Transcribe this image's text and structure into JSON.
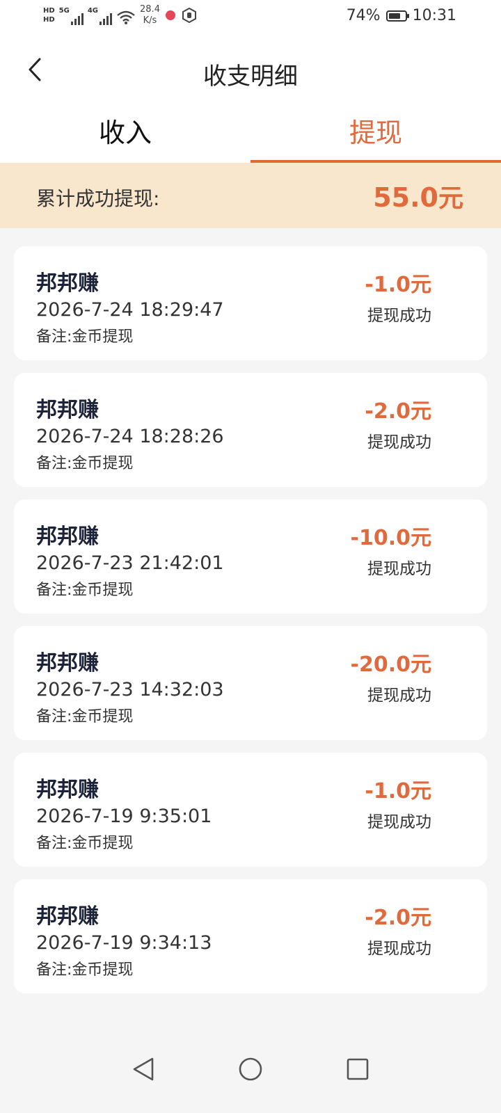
{
  "status_bar": {
    "hd_top": "HD",
    "hd_bottom": "HD",
    "net_5g": "5G",
    "net_4g": "4G",
    "speed_value": "28.4",
    "speed_unit": "K/s",
    "battery_percent": "74%",
    "battery_level": 0.74,
    "time": "10:31"
  },
  "header": {
    "title": "收支明细",
    "back_icon": "chevron-left-icon"
  },
  "tabs": [
    {
      "label": "收入",
      "active": false
    },
    {
      "label": "提现",
      "active": true
    }
  ],
  "summary": {
    "label": "累计成功提现:",
    "amount": "55.0",
    "unit": "元"
  },
  "records": [
    {
      "name": "邦邦赚",
      "time": "2026-7-24 18:29:47",
      "note": "备注:金币提现",
      "amount": "-1.0元",
      "status": "提现成功"
    },
    {
      "name": "邦邦赚",
      "time": "2026-7-24 18:28:26",
      "note": "备注:金币提现",
      "amount": "-2.0元",
      "status": "提现成功"
    },
    {
      "name": "邦邦赚",
      "time": "2026-7-23 21:42:01",
      "note": "备注:金币提现",
      "amount": "-10.0元",
      "status": "提现成功"
    },
    {
      "name": "邦邦赚",
      "time": "2026-7-23 14:32:03",
      "note": "备注:金币提现",
      "amount": "-20.0元",
      "status": "提现成功"
    },
    {
      "name": "邦邦赚",
      "time": "2026-7-19 9:35:01",
      "note": "备注:金币提现",
      "amount": "-1.0元",
      "status": "提现成功"
    },
    {
      "name": "邦邦赚",
      "time": "2026-7-19 9:34:13",
      "note": "备注:金币提现",
      "amount": "-2.0元",
      "status": "提现成功"
    }
  ],
  "colors": {
    "accent": "#e06a3c",
    "summary_bg": "#f9e7cd",
    "page_bg": "#f5f5f5"
  },
  "nav_bar": {
    "back": "triangle-back-icon",
    "home": "circle-home-icon",
    "recents": "square-recents-icon"
  }
}
